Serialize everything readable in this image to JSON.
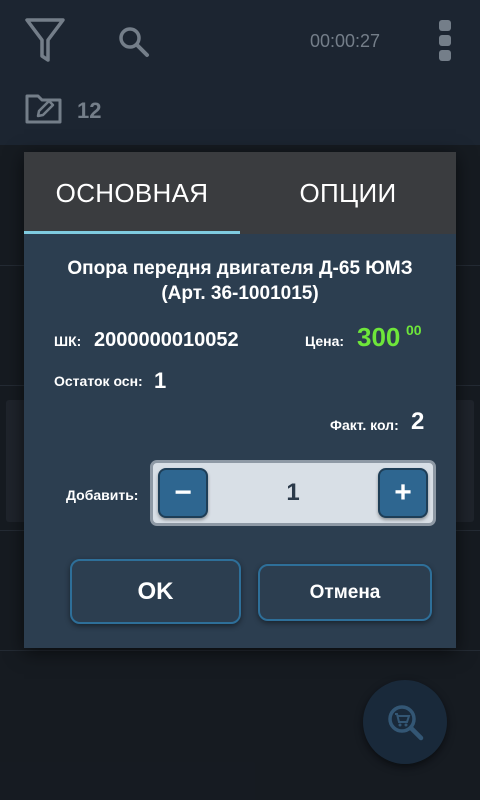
{
  "app": {
    "timer": "00:00:27",
    "folder_count": "12"
  },
  "dialog": {
    "tabs": [
      {
        "label": "ОСНОВНАЯ",
        "active": true
      },
      {
        "label": "ОПЦИИ",
        "active": false
      }
    ],
    "product_name_line1": "Опора передня двигателя Д-65 ЮМЗ",
    "product_name_line2": "(Арт. 36-1001015)",
    "barcode_label": "ШК:",
    "barcode_value": "2000000010052",
    "price_label": "Цена:",
    "price_main": "300",
    "price_cents": "00",
    "stock_label": "Остаток осн:",
    "stock_value": "1",
    "actual_qty_label": "Факт. кол:",
    "actual_qty_value": "2",
    "add_label": "Добавить:",
    "stepper": {
      "minus": "−",
      "value": "1",
      "plus": "+"
    },
    "ok_label": "OK",
    "cancel_label": "Отмена"
  },
  "colors": {
    "accent": "#7fcbe0",
    "price": "#6ee63a",
    "dialog_bg": "#2c3e50",
    "button_border": "#2e6f99"
  },
  "icons": {
    "filter": "filter-icon",
    "search": "search-icon",
    "menu": "more-vertical-icon",
    "folder": "folder-edit-icon",
    "fab": "search-cart-icon"
  }
}
